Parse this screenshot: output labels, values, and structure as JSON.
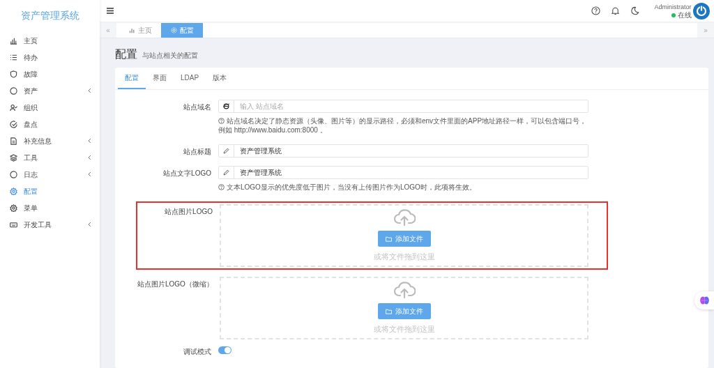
{
  "sidebar": {
    "title": "资产管理系统",
    "items": [
      {
        "label": "主页",
        "selected": false,
        "expandable": false
      },
      {
        "label": "待办",
        "selected": false,
        "expandable": false
      },
      {
        "label": "故障",
        "selected": false,
        "expandable": false
      },
      {
        "label": "资产",
        "selected": false,
        "expandable": true
      },
      {
        "label": "组织",
        "selected": false,
        "expandable": false
      },
      {
        "label": "盘点",
        "selected": false,
        "expandable": false
      },
      {
        "label": "补充信息",
        "selected": false,
        "expandable": true
      },
      {
        "label": "工具",
        "selected": false,
        "expandable": true
      },
      {
        "label": "日志",
        "selected": false,
        "expandable": true
      },
      {
        "label": "配置",
        "selected": true,
        "expandable": false
      },
      {
        "label": "菜单",
        "selected": false,
        "expandable": false
      },
      {
        "label": "开发工具",
        "selected": false,
        "expandable": true
      }
    ]
  },
  "header": {
    "user": "Administrator",
    "status": "在线",
    "online": true
  },
  "tab_scroll": {
    "left": "«",
    "right": "»"
  },
  "page_tabs": [
    {
      "label": "主页",
      "selected": false
    },
    {
      "label": "配置",
      "selected": true
    }
  ],
  "page": {
    "title": "配置",
    "subtitle": "与站点相关的配置"
  },
  "card_tabs": [
    {
      "label": "配置",
      "selected": true
    },
    {
      "label": "界面",
      "selected": false
    },
    {
      "label": "LDAP",
      "selected": false
    },
    {
      "label": "版本",
      "selected": false
    }
  ],
  "fields": [
    {
      "kind": "text",
      "label": "站点域名",
      "placeholder": "输入 站点域名",
      "help": "站点域名决定了静态资源（头像、图片等）的显示路径，必须和env文件里面的APP地址路径一样，可以包含端口号，例如 http://www.baidu.com:8000 。"
    },
    {
      "kind": "text",
      "label": "站点标题",
      "value": "资产管理系统"
    },
    {
      "kind": "text",
      "label": "站点文字LOGO",
      "value": "资产管理系统",
      "help": "文本LOGO显示的优先度低于图片，当没有上传图片作为LOGO时，此项将生效。"
    },
    {
      "kind": "upload",
      "label": "站点图片LOGO",
      "button": "添加文件",
      "hint": "或将文件拖到这里",
      "highlighted": true
    },
    {
      "kind": "upload",
      "label": "站点图片LOGO（微缩）",
      "button": "添加文件",
      "hint": "或将文件拖到这里",
      "highlighted": false
    },
    {
      "kind": "switch",
      "label": "调试模式",
      "on": true
    }
  ]
}
